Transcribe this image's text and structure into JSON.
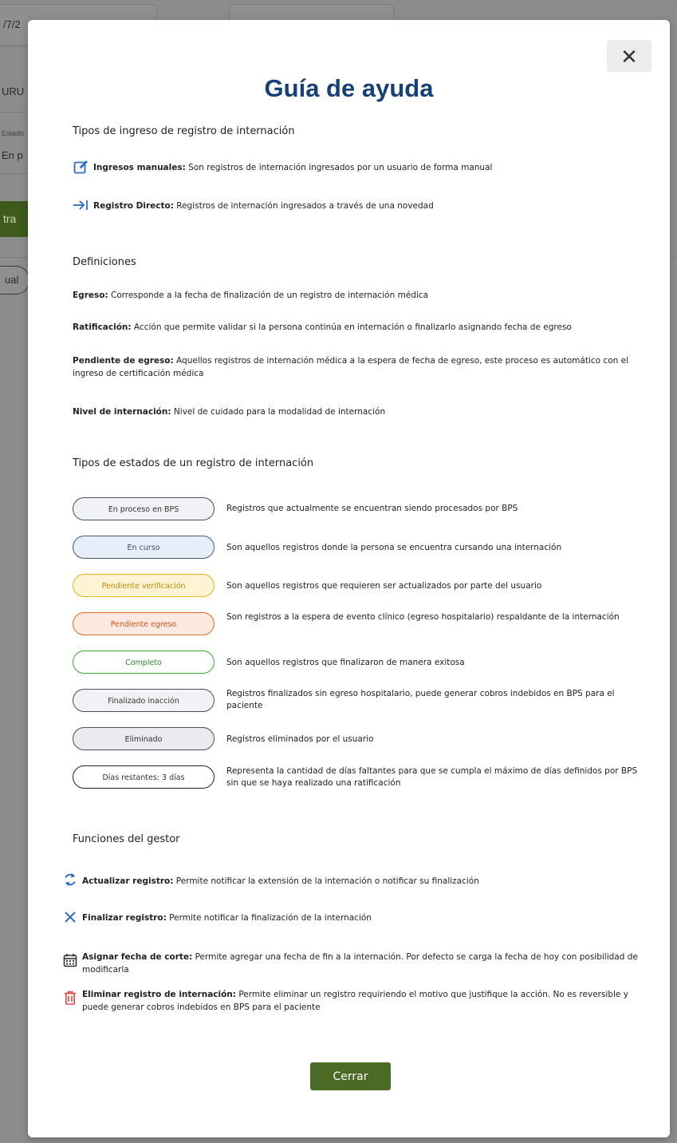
{
  "background": {
    "date_fragment": "/7/2",
    "field_fragment": "URU",
    "estado_label": "Estado",
    "estado_value": "En p",
    "button_fragment": "tra",
    "chip_fragment": "ual"
  },
  "modal": {
    "close_symbol": "✕",
    "title": "Guía de ayuda",
    "sections": {
      "ingreso": {
        "title": "Tipos de ingreso de registro de internación",
        "items": [
          {
            "label": "Ingresos manuales:",
            "text": " Son registros de internación ingresados por un usuario de forma manual",
            "icon": "edit-icon"
          },
          {
            "label": "Registro Directo:",
            "text": " Registros de internación ingresados a través de una novedad",
            "icon": "arrow-right-bar-icon"
          }
        ]
      },
      "definiciones": {
        "title": "Definiciones",
        "items": [
          {
            "label": "Egreso:",
            "text": " Corresponde a la fecha de finalización de un registro de internación médica"
          },
          {
            "label": "Ratificación:",
            "text": " Acción que permite validar si la persona continúa en internación o finalizarlo asignando fecha de egreso"
          },
          {
            "label": "Pendiente de egreso:",
            "text": " Aquellos registros de internación médica a la espera de fecha de egreso, este proceso es automático con el ingreso de certificación médica"
          },
          {
            "label": "Nivel de internación:",
            "text": " Nivel de cuidado para la modalidad de internación"
          }
        ]
      },
      "estados": {
        "title": "Tipos de estados de un registro de internación",
        "items": [
          {
            "pill": "En proceso en BPS",
            "desc": "Registros que actualmente se encuentran siendo procesados por BPS",
            "bg": "#f0f2f5",
            "border": "#4a4f57",
            "color": "#333333"
          },
          {
            "pill": "En curso",
            "desc": "Son aquellos registros donde la persona se encuentra cursando una internación",
            "bg": "#e6eef9",
            "border": "#4a5a70",
            "color": "#3c4e66"
          },
          {
            "pill": "Pendiente verificación",
            "desc": "Son aquellos registros que requieren ser actualizados por parte del usuario",
            "bg": "#fdf4d5",
            "border": "#e6b420",
            "color": "#c48a00"
          },
          {
            "pill": "Pendiente egreso",
            "desc": "Son registros a la espera de evento clínico (egreso hospitalario) respaldante de la internación",
            "bg": "#fde9e0",
            "border": "#e06a2a",
            "color": "#d9531e"
          },
          {
            "pill": "Completo",
            "desc": "Son aquellos registros que finalizaron de manera exitosa",
            "bg": "#ffffff",
            "border": "#3aa635",
            "color": "#2e8a2a"
          },
          {
            "pill": "Finalizado inacción",
            "desc": "Registros finalizados sin egreso hospitalario, puede generar cobros indebidos en BPS para el paciente",
            "bg": "#f0f2f5",
            "border": "#4a4f57",
            "color": "#333333"
          },
          {
            "pill": "Eliminado",
            "desc": "Registros eliminados por el usuario",
            "bg": "#e9ebef",
            "border": "#4a4f57",
            "color": "#333333"
          },
          {
            "pill": "Días restantes: 3 días",
            "desc": "Representa la cantidad de días faltantes para que se cumpla el máximo de días definidos por BPS sin que se haya realizado una ratificación",
            "bg": "#ffffff",
            "border": "#222222",
            "color": "#333333"
          }
        ]
      },
      "funciones": {
        "title": "Funciones del gestor",
        "items": [
          {
            "label": "Actualizar registro:",
            "text": " Permite notificar la extensión de la internación o notificar su finalización",
            "icon": "refresh-icon"
          },
          {
            "label": "Finalizar registro:",
            "text": " Permite notificar la finalización de la internación",
            "icon": "close-x-icon"
          },
          {
            "label": "Asignar fecha de corte:",
            "text": " Permite agregar una fecha de fin a la internación. Por defecto se carga la fecha de hoy con posibilidad de modificarla",
            "icon": "calendar-icon"
          },
          {
            "label": "Eliminar registro de internación:",
            "text": " Permite eliminar un registro requiriendo el motivo que justifique la acción. No es reversible y puede generar cobros indebidos en BPS para el paciente",
            "icon": "trash-icon"
          }
        ]
      }
    },
    "close_button_label": "Cerrar"
  },
  "colors": {
    "title": "#173f78",
    "accent_blue": "#2b6cc4",
    "primary_button": "#4b6b24",
    "trash_red": "#d94b4b"
  }
}
